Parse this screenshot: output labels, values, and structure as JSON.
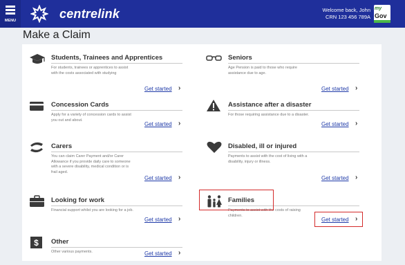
{
  "header": {
    "menu_label": "MENU",
    "logo_text": "centrelink",
    "welcome_line": "Welcome back, John",
    "crn_line": "CRN 123 456 789A",
    "mygov_top": "my",
    "mygov_bottom": "Gov",
    "bar_color": "#1f2f9b"
  },
  "page": {
    "title": "Make a Claim"
  },
  "claims": {
    "students": {
      "icon": "graduation-cap-icon",
      "title": "Students, Trainees and Apprentices",
      "description": "For students, trainees or apprentices to assist with the costs associated with studying",
      "link": "Get started"
    },
    "seniors": {
      "icon": "glasses-icon",
      "title": "Seniors",
      "description": "Age Pension is paid to those who require assistance due to age.",
      "link": "Get started"
    },
    "concession": {
      "icon": "card-icon",
      "title": "Concession Cards",
      "description": "Apply for a variety of concession cards to assist you out and about.",
      "link": "Get started"
    },
    "disaster": {
      "icon": "warning-icon",
      "title": "Assistance after a disaster",
      "description": "For those requiring assistance due to a disaster.",
      "link": "Get started"
    },
    "carers": {
      "icon": "carer-icon",
      "title": "Carers",
      "description": "You can claim Carer Payment and/or Carer Allowance if you provide daily care to someone with a severe disability, medical condition or is frail aged.",
      "link": "Get started"
    },
    "disabled": {
      "icon": "heart-icon",
      "title": "Disabled, ill or injured",
      "description": "Payments to assist with the cost of living with a disability, injury or illness.",
      "link": "Get started"
    },
    "work": {
      "icon": "briefcase-icon",
      "title": "Looking for work",
      "description": "Financial support whilst you are looking for a job.",
      "link": "Get started"
    },
    "families": {
      "icon": "family-icon",
      "title": "Families",
      "description": "Payments to assist with the costs of raising children.",
      "link": "Get started"
    },
    "other": {
      "icon": "dollar-icon",
      "title": "Other",
      "description": "Other various payments.",
      "link": "Get started"
    }
  },
  "colors": {
    "highlight": "#d42a2a",
    "link": "#1f3aa8"
  }
}
